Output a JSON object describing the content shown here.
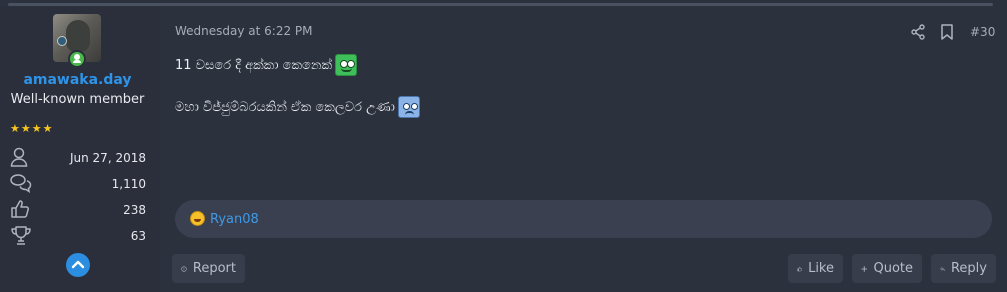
{
  "user": {
    "username": "amawaka.day",
    "title": "Well-known member",
    "stars": "★★★★",
    "stats": [
      {
        "icon": "user-icon",
        "value": "Jun 27, 2018"
      },
      {
        "icon": "messages-icon",
        "value": "1,110"
      },
      {
        "icon": "thumbs-up-icon",
        "value": "238"
      },
      {
        "icon": "trophy-icon",
        "value": "63"
      }
    ]
  },
  "post": {
    "timestamp": "Wednesday at 6:22 PM",
    "number": "#30",
    "lines": [
      "11 වසරෙ දී අක්කා කෙනෙක්",
      "මහා විජ්ජුම්බරයකින් ඒක කෙලවර උණා"
    ]
  },
  "reactions": {
    "user": "Ryan08",
    "emoji": "laughing-emoji-icon"
  },
  "buttons": {
    "report": "Report",
    "like": "Like",
    "quote": "Quote",
    "reply": "Reply"
  },
  "colors": {
    "background": "#2c313e",
    "accent": "#2f94e8",
    "stars": "#f7c51e",
    "online": "#49b94b"
  }
}
